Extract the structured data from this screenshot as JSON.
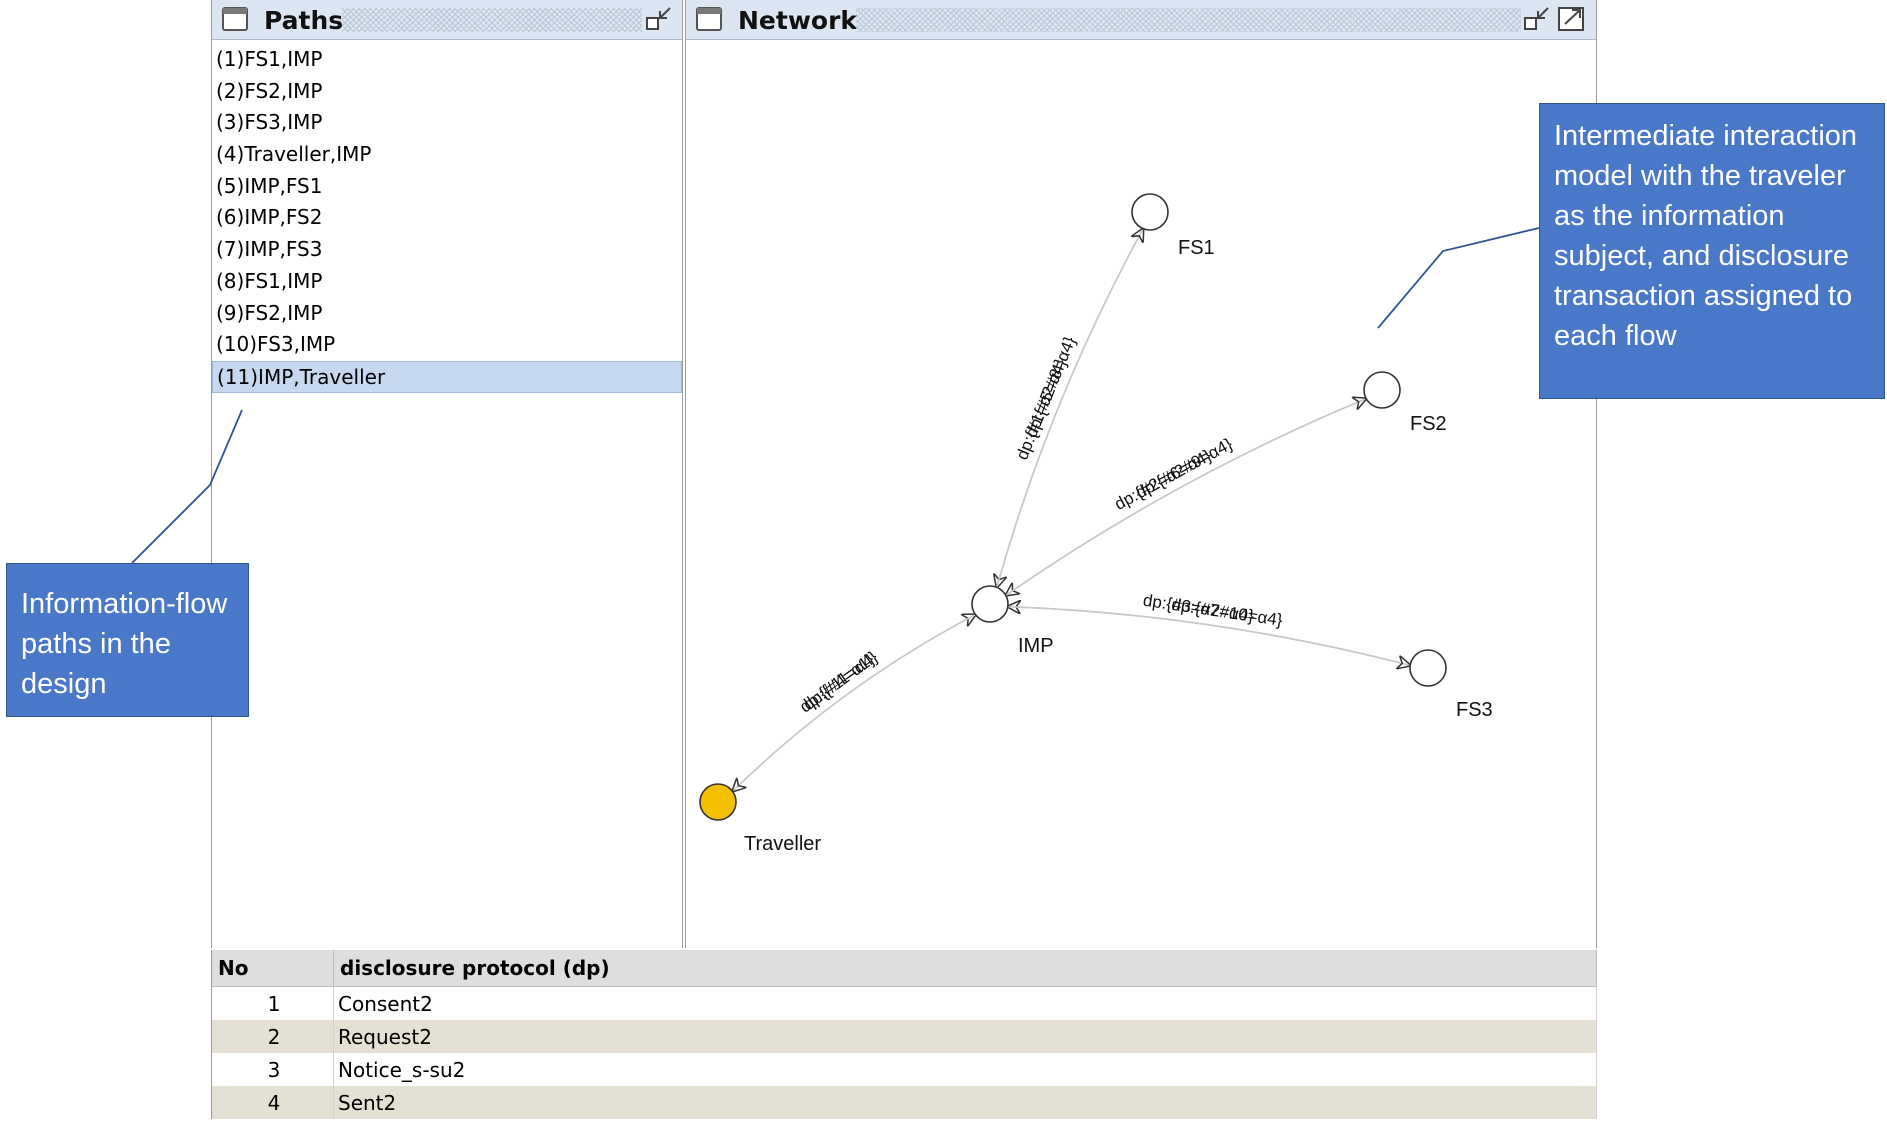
{
  "paths_panel": {
    "title": "Paths",
    "items": [
      {
        "label": "(1)FS1,IMP",
        "selected": false
      },
      {
        "label": "(2)FS2,IMP",
        "selected": false
      },
      {
        "label": "(3)FS3,IMP",
        "selected": false
      },
      {
        "label": "(4)Traveller,IMP",
        "selected": false
      },
      {
        "label": "(5)IMP,FS1",
        "selected": false
      },
      {
        "label": "(6)IMP,FS2",
        "selected": false
      },
      {
        "label": "(7)IMP,FS3",
        "selected": false
      },
      {
        "label": "(8)FS1,IMP",
        "selected": false
      },
      {
        "label": "(9)FS2,IMP",
        "selected": false
      },
      {
        "label": "(10)FS3,IMP",
        "selected": false
      },
      {
        "label": "(11)IMP,Traveller",
        "selected": true
      }
    ]
  },
  "network_panel": {
    "title": "Network",
    "nodes": [
      {
        "id": "FS1",
        "label": "FS1",
        "highlighted": false
      },
      {
        "id": "FS2",
        "label": "FS2",
        "highlighted": false
      },
      {
        "id": "FS3",
        "label": "FS3",
        "highlighted": false
      },
      {
        "id": "IMP",
        "label": "IMP",
        "highlighted": false
      },
      {
        "id": "Traveller",
        "label": "Traveller",
        "highlighted": true
      }
    ],
    "edges": [
      {
        "from": "FS1",
        "to": "IMP",
        "label": "dp:{#1=α2#8=α4}"
      },
      {
        "from": "IMP",
        "to": "FS1",
        "label": "dp:{#5=α4}"
      },
      {
        "from": "FS2",
        "to": "IMP",
        "label": "dp:{#2=α2#9=α4}"
      },
      {
        "from": "IMP",
        "to": "FS2",
        "label": "dp:{#6=α4}"
      },
      {
        "from": "FS3",
        "to": "IMP",
        "label": "dp:{#3=α2#10=α4}"
      },
      {
        "from": "IMP",
        "to": "FS3",
        "label": "dp:{#7=α4}"
      },
      {
        "from": "Traveller",
        "to": "IMP",
        "label": "dp:{#4=α1}"
      },
      {
        "from": "IMP",
        "to": "Traveller",
        "label": "dp:{#11=α4}"
      }
    ],
    "colors": {
      "node_fill": "#ffffff",
      "highlight_fill": "#f5c000",
      "edge": "#c8c8c8"
    }
  },
  "protocol_table": {
    "headers": [
      "No",
      "disclosure protocol (dp)"
    ],
    "rows": [
      [
        "1",
        "Consent2"
      ],
      [
        "2",
        "Request2"
      ],
      [
        "3",
        "Notice_s-su2"
      ],
      [
        "4",
        "Sent2"
      ]
    ]
  },
  "annotations": {
    "left": "Information-flow paths in the design",
    "right": "Intermediate interaction model with the traveler as the information subject, and disclosure transaction assigned to each flow",
    "color": "#4a78c8"
  }
}
